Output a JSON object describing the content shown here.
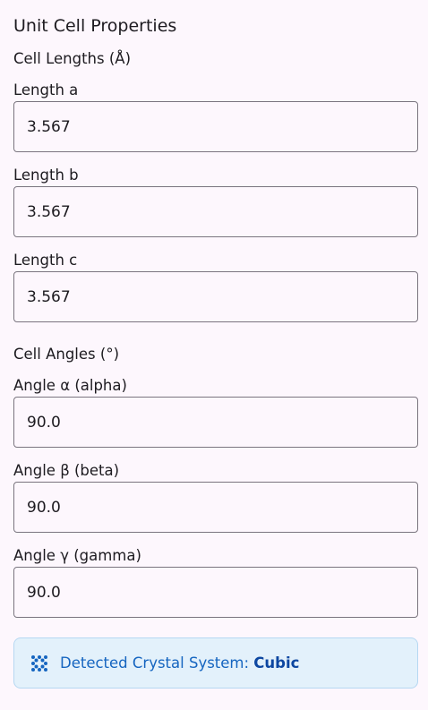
{
  "panel": {
    "title": "Unit Cell Properties"
  },
  "lengths": {
    "heading": "Cell Lengths (Å)",
    "a": {
      "label": "Length a",
      "value": "3.567"
    },
    "b": {
      "label": "Length b",
      "value": "3.567"
    },
    "c": {
      "label": "Length c",
      "value": "3.567"
    }
  },
  "angles": {
    "heading": "Cell Angles (°)",
    "alpha": {
      "label": "Angle α (alpha)",
      "value": "90.0"
    },
    "beta": {
      "label": "Angle β (beta)",
      "value": "90.0"
    },
    "gamma": {
      "label": "Angle γ (gamma)",
      "value": "90.0"
    }
  },
  "crystal_system": {
    "icon": "lattice-grid-icon",
    "label": "Detected Crystal System: ",
    "value": "Cubic"
  },
  "colors": {
    "background": "#fdf7fd",
    "input_border": "#7a757f",
    "status_bg": "#e3f1fb",
    "status_border": "#b6d8f2",
    "status_text": "#1565c0",
    "status_value": "#0d47a1"
  }
}
